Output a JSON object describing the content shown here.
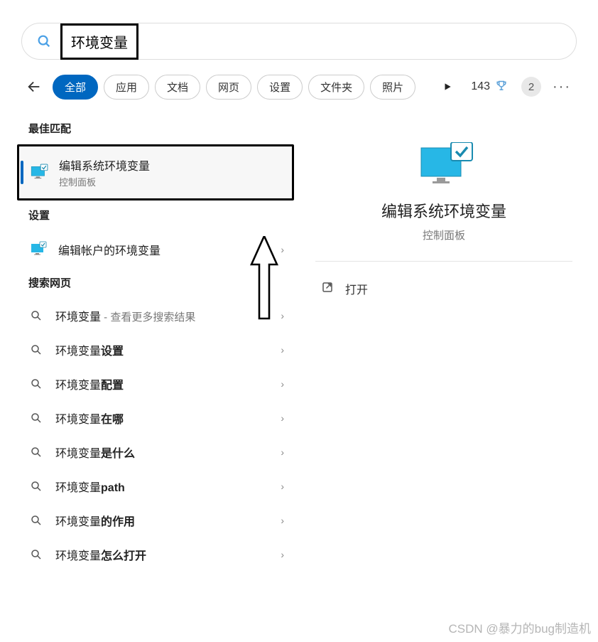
{
  "search": {
    "query": "环境变量"
  },
  "filters": {
    "items": [
      {
        "label": "全部",
        "active": true
      },
      {
        "label": "应用",
        "active": false
      },
      {
        "label": "文档",
        "active": false
      },
      {
        "label": "网页",
        "active": false
      },
      {
        "label": "设置",
        "active": false
      },
      {
        "label": "文件夹",
        "active": false
      },
      {
        "label": "照片",
        "active": false
      }
    ]
  },
  "rewards": {
    "points": "143"
  },
  "notifications": {
    "count": "2"
  },
  "groups": {
    "best_match_label": "最佳匹配",
    "settings_label": "设置",
    "web_label": "搜索网页"
  },
  "best_match": {
    "title": "编辑系统环境变量",
    "subtitle": "控制面板"
  },
  "settings_items": [
    {
      "title": "编辑帐户的环境变量"
    }
  ],
  "web_items": [
    {
      "prefix": "环境变量",
      "bold": "",
      "suffix": " - 查看更多搜索结果"
    },
    {
      "prefix": "环境变量",
      "bold": "设置",
      "suffix": ""
    },
    {
      "prefix": "环境变量",
      "bold": "配置",
      "suffix": ""
    },
    {
      "prefix": "环境变量",
      "bold": "在哪",
      "suffix": ""
    },
    {
      "prefix": "环境变量",
      "bold": "是什么",
      "suffix": ""
    },
    {
      "prefix": "环境变量",
      "bold": "path",
      "suffix": ""
    },
    {
      "prefix": "环境变量",
      "bold": "的作用",
      "suffix": ""
    },
    {
      "prefix": "环境变量",
      "bold": "怎么打开",
      "suffix": ""
    }
  ],
  "detail": {
    "title": "编辑系统环境变量",
    "subtitle": "控制面板",
    "open_label": "打开"
  },
  "watermark": "CSDN @暴力的bug制造机"
}
